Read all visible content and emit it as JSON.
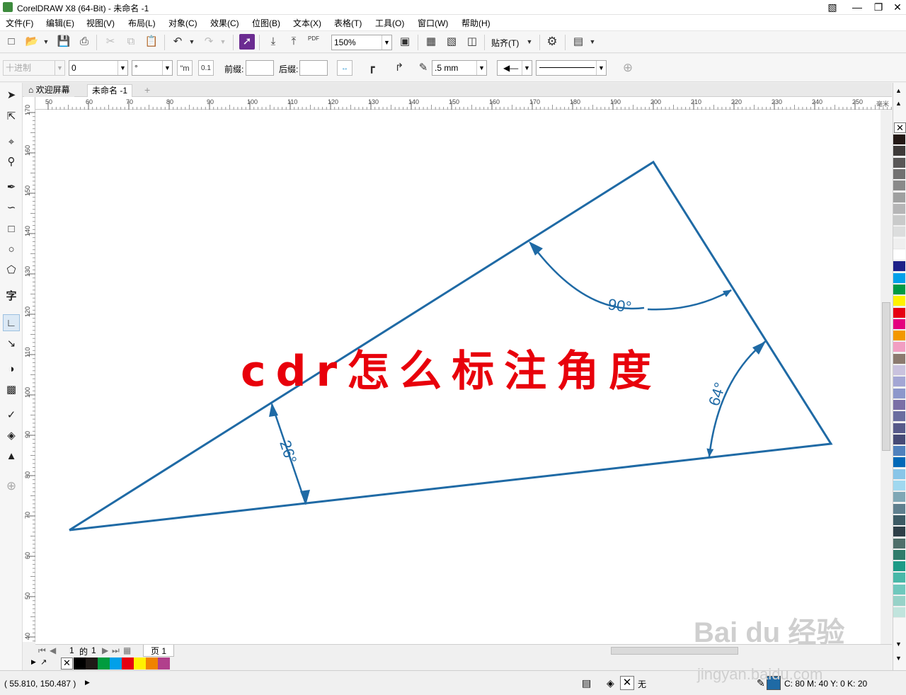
{
  "window": {
    "title": "CorelDRAW X8 (64-Bit) - 未命名 -1"
  },
  "menu": [
    "文件(F)",
    "编辑(E)",
    "视图(V)",
    "布局(L)",
    "对象(C)",
    "效果(C)",
    "位图(B)",
    "文本(X)",
    "表格(T)",
    "工具(O)",
    "窗口(W)",
    "帮助(H)"
  ],
  "toolbar": {
    "zoom": "150%",
    "pdf_label": "PDF",
    "snap_label": "贴齐(T)"
  },
  "propbar": {
    "style": "十进制",
    "precision": "0",
    "units": "°",
    "prefix_label": "前缀:",
    "prefix_value": "",
    "suffix_label": "后缀:",
    "suffix_value": "",
    "outline_width": ".5 mm"
  },
  "doctabs": {
    "welcome": "欢迎屏幕",
    "doc": "未命名 -1"
  },
  "hruler": {
    "ticks": [
      "50",
      "60",
      "70",
      "80",
      "90",
      "100",
      "110",
      "120",
      "130",
      "140",
      "150",
      "160",
      "170",
      "180",
      "190",
      "200",
      "210",
      "220",
      "230",
      "240",
      "250"
    ],
    "units": "毫米"
  },
  "vruler": {
    "ticks": [
      "170",
      "160",
      "150",
      "140",
      "130",
      "120",
      "110",
      "100",
      "90",
      "80",
      "70",
      "60",
      "50",
      "40"
    ]
  },
  "canvas": {
    "headline": "cdr怎么标注角度",
    "headline_color": "#e8000b",
    "line_color": "#1f6aa5",
    "angles": {
      "a90": "90°",
      "a64": "64°",
      "a26": "26°"
    }
  },
  "pagenav": {
    "page_current": "1",
    "of": "的",
    "page_total": "1",
    "page_tab": "页 1"
  },
  "docpalette": [
    "#000000",
    "#1f1a17",
    "#009c3e",
    "#00a0e9",
    "#e60012",
    "#fff100",
    "#f08300",
    "#b13f8c"
  ],
  "palette": [
    "#231815",
    "#3e3a39",
    "#595757",
    "#727171",
    "#898989",
    "#9fa0a0",
    "#b5b5b6",
    "#c9caca",
    "#dcdddd",
    "#efefef",
    "#ffffff",
    "#1d2088",
    "#00a0e9",
    "#009944",
    "#fff100",
    "#e60012",
    "#e4007f",
    "#f39800",
    "#f19ec2",
    "#8b7a6f",
    "#c9c2de",
    "#a3a6d4",
    "#8c97cb",
    "#7a6fa6",
    "#6a6d9f",
    "#575a8a",
    "#464a76",
    "#4f81bd",
    "#0068b7",
    "#88c5e8",
    "#a0d8ef",
    "#7fa7b5",
    "#5f7f8e",
    "#3c5a64",
    "#2e3f48",
    "#4f6f6a",
    "#2f7b6a",
    "#1c9a86",
    "#48b8a8",
    "#6fc8bd",
    "#97d2c8",
    "#c1e4dd"
  ],
  "status": {
    "coords": "( 55.810, 150.487 )",
    "fill_none": "无",
    "outline_color": "#1f6aa5",
    "outline_text": "C: 80 M: 40 Y: 0 K: 20"
  },
  "watermark": {
    "brand": "Bai du 经验",
    "url": "jingyan.baidu.com"
  }
}
